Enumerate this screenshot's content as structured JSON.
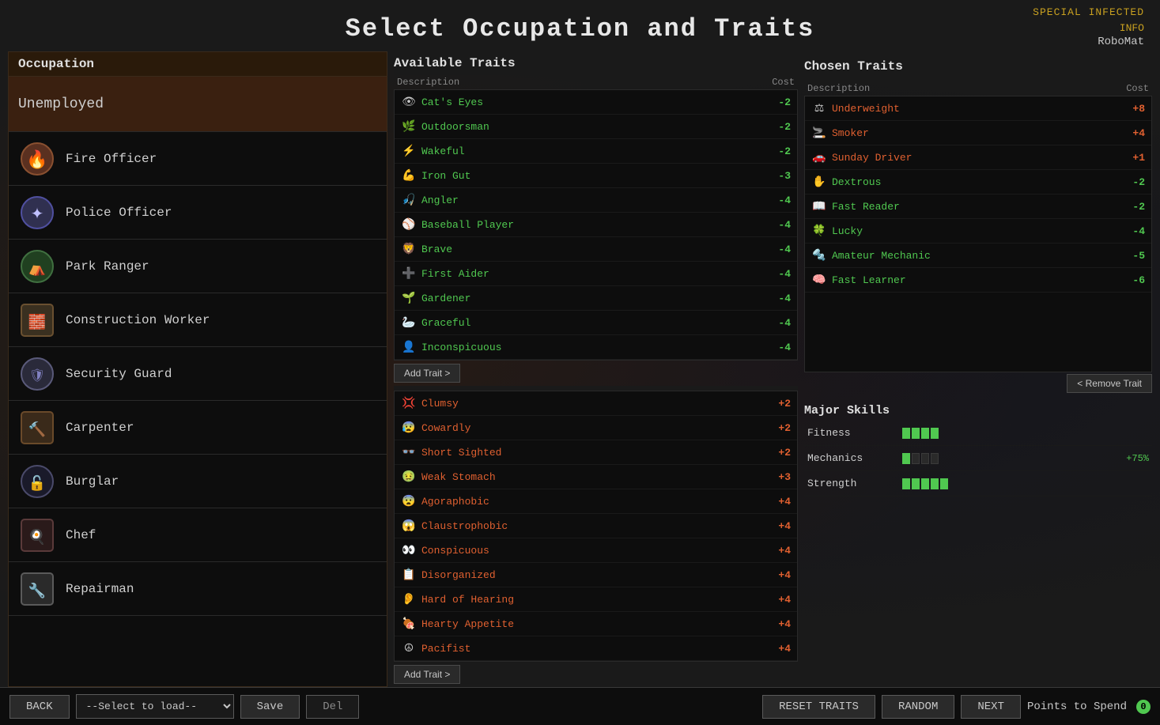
{
  "header": {
    "title": "Select Occupation and Traits",
    "special_text": "SPECIAL INFECTED",
    "info_text": "INFO",
    "robomat_text": "RoboMat"
  },
  "occupation_panel": {
    "label": "Occupation",
    "items": [
      {
        "id": "unemployed",
        "name": "Unemployed",
        "icon": "none",
        "selected": false
      },
      {
        "id": "fire-officer",
        "name": "Fire Officer",
        "icon": "fire"
      },
      {
        "id": "police-officer",
        "name": "Police Officer",
        "icon": "police"
      },
      {
        "id": "park-ranger",
        "name": "Park Ranger",
        "icon": "ranger"
      },
      {
        "id": "construction-worker",
        "name": "Construction Worker",
        "icon": "construction"
      },
      {
        "id": "security-guard",
        "name": "Security Guard",
        "icon": "security"
      },
      {
        "id": "carpenter",
        "name": "Carpenter",
        "icon": "carpenter"
      },
      {
        "id": "burglar",
        "name": "Burglar",
        "icon": "burglar"
      },
      {
        "id": "chef",
        "name": "Chef",
        "icon": "chef"
      },
      {
        "id": "repairman",
        "name": "Repairman",
        "icon": "repairman"
      }
    ]
  },
  "available_traits": {
    "label": "Available Traits",
    "col_description": "Description",
    "col_cost": "Cost",
    "add_button": "Add Trait >",
    "positive_traits": [
      {
        "name": "Cat's Eyes",
        "cost": "-2",
        "type": "positive"
      },
      {
        "name": "Outdoorsman",
        "cost": "-2",
        "type": "positive"
      },
      {
        "name": "Wakeful",
        "cost": "-2",
        "type": "positive"
      },
      {
        "name": "Iron Gut",
        "cost": "-3",
        "type": "positive"
      },
      {
        "name": "Angler",
        "cost": "-4",
        "type": "positive"
      },
      {
        "name": "Baseball Player",
        "cost": "-4",
        "type": "positive"
      },
      {
        "name": "Brave",
        "cost": "-4",
        "type": "positive"
      },
      {
        "name": "First Aider",
        "cost": "-4",
        "type": "positive"
      },
      {
        "name": "Gardener",
        "cost": "-4",
        "type": "positive"
      },
      {
        "name": "Graceful",
        "cost": "-4",
        "type": "positive"
      },
      {
        "name": "Inconspicuous",
        "cost": "-4",
        "type": "positive"
      }
    ],
    "negative_traits": [
      {
        "name": "Clumsy",
        "cost": "+2",
        "type": "negative"
      },
      {
        "name": "Cowardly",
        "cost": "+2",
        "type": "negative"
      },
      {
        "name": "Short Sighted",
        "cost": "+2",
        "type": "negative"
      },
      {
        "name": "Weak Stomach",
        "cost": "+3",
        "type": "negative"
      },
      {
        "name": "Agoraphobic",
        "cost": "+4",
        "type": "negative"
      },
      {
        "name": "Claustrophobic",
        "cost": "+4",
        "type": "negative"
      },
      {
        "name": "Conspicuous",
        "cost": "+4",
        "type": "negative"
      },
      {
        "name": "Disorganized",
        "cost": "+4",
        "type": "negative"
      },
      {
        "name": "Hard of Hearing",
        "cost": "+4",
        "type": "negative"
      },
      {
        "name": "Hearty Appetite",
        "cost": "+4",
        "type": "negative"
      },
      {
        "name": "Pacifist",
        "cost": "+4",
        "type": "negative"
      }
    ]
  },
  "chosen_traits": {
    "label": "Chosen Traits",
    "col_description": "Description",
    "col_cost": "Cost",
    "remove_button": "< Remove Trait",
    "items": [
      {
        "name": "Underweight",
        "cost": "+8",
        "type": "negative"
      },
      {
        "name": "Smoker",
        "cost": "+4",
        "type": "negative"
      },
      {
        "name": "Sunday Driver",
        "cost": "+1",
        "type": "negative"
      },
      {
        "name": "Dextrous",
        "cost": "-2",
        "type": "positive"
      },
      {
        "name": "Fast Reader",
        "cost": "-2",
        "type": "positive"
      },
      {
        "name": "Lucky",
        "cost": "-4",
        "type": "positive"
      },
      {
        "name": "Amateur Mechanic",
        "cost": "-5",
        "type": "positive"
      },
      {
        "name": "Fast Learner",
        "cost": "-6",
        "type": "positive"
      }
    ]
  },
  "major_skills": {
    "label": "Major Skills",
    "skills": [
      {
        "name": "Fitness",
        "bars": 4,
        "max_bars": 4,
        "bonus": ""
      },
      {
        "name": "Mechanics",
        "bars": 1,
        "max_bars": 4,
        "bonus": "+75%"
      },
      {
        "name": "Strength",
        "bars": 5,
        "max_bars": 5,
        "bonus": ""
      }
    ]
  },
  "bottom_bar": {
    "back_label": "BACK",
    "load_placeholder": "--Select to load--",
    "save_label": "Save",
    "del_label": "Del",
    "reset_label": "RESET TRAITS",
    "random_label": "RANDOM",
    "next_label": "NEXT",
    "points_label": "Points to Spend",
    "points_value": "0"
  }
}
